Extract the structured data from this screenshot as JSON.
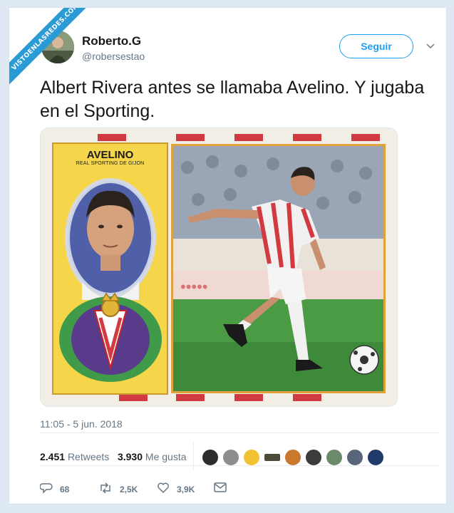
{
  "watermark": "VISTOENLASREDES.COM",
  "author": {
    "name": "Roberto.G",
    "handle": "@robersestao"
  },
  "follow_label": "Seguir",
  "tweet_text": "Albert Rivera antes se llamaba Avelino. Y jugaba en el Sporting.",
  "card": {
    "player_name": "AVELINO",
    "club": "REAL SPORTING DE GIJON",
    "shirt_text": "AVELINO"
  },
  "timestamp": "11:05 - 5 jun. 2018",
  "stats": {
    "retweets_count": "2.451",
    "retweets_label": "Retweets",
    "likes_count": "3.930",
    "likes_label": "Me gusta"
  },
  "actions": {
    "reply_count": "68",
    "retweet_count": "2,5K",
    "like_count": "3,9K"
  },
  "icons": [
    "reply-icon",
    "retweet-icon",
    "like-icon",
    "message-icon",
    "chevron-down-icon"
  ],
  "colors": {
    "accent": "#1da1f2",
    "stripe_red": "#d23a42",
    "card_yellow": "#f5d64a"
  }
}
